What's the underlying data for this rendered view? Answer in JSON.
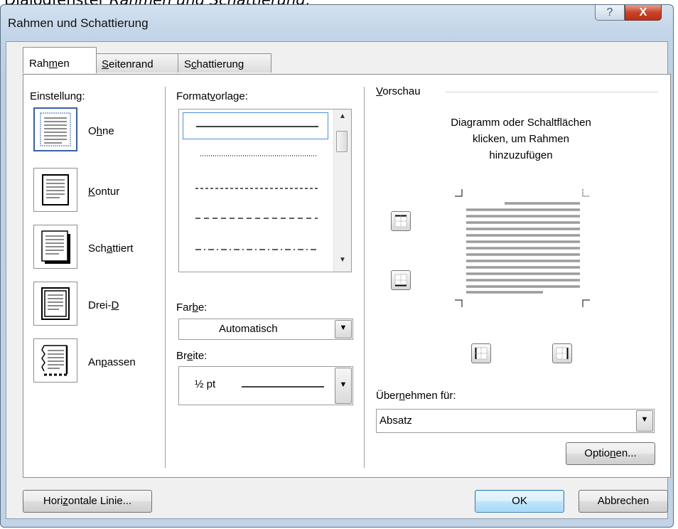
{
  "caption": {
    "prefix": "Dialogfenster ",
    "title": "Rahmen und Schattierung",
    "suffix": "."
  },
  "window": {
    "title": "Rahmen und Schattierung",
    "help_glyph": "?",
    "close_glyph": "X"
  },
  "tabs": [
    {
      "pre": "Rah",
      "key": "m",
      "post": "en",
      "active": true
    },
    {
      "pre": "",
      "key": "S",
      "post": "eitenrand",
      "active": false
    },
    {
      "pre": "S",
      "key": "c",
      "post": "hattierung",
      "active": false
    }
  ],
  "settings": {
    "heading": "Einstellung:",
    "items": [
      {
        "pre": "O",
        "key": "h",
        "post": "ne",
        "icon": "setting-none-icon"
      },
      {
        "pre": "",
        "key": "K",
        "post": "ontur",
        "icon": "setting-box-icon"
      },
      {
        "pre": "Sch",
        "key": "a",
        "post": "ttiert",
        "icon": "setting-shadow-icon"
      },
      {
        "pre": "Drei-",
        "key": "D",
        "post": "",
        "icon": "setting-3d-icon"
      },
      {
        "pre": "An",
        "key": "p",
        "post": "assen",
        "icon": "setting-custom-icon"
      }
    ]
  },
  "style": {
    "heading_pre": "Format",
    "heading_key": "v",
    "heading_post": "orlage:",
    "line_styles": [
      "solid",
      "dotted",
      "dashed-small",
      "dashed",
      "dash-dot"
    ],
    "color_label_pre": "Far",
    "color_label_key": "b",
    "color_label_post": "e:",
    "color_value": "Automatisch",
    "width_label_pre": "Br",
    "width_label_key": "e",
    "width_label_post": "ite:",
    "width_value": "½ pt"
  },
  "preview": {
    "heading_pre": "",
    "heading_key": "V",
    "heading_post": "orschau",
    "hint_lines": [
      "Diagramm oder Schaltflächen",
      "klicken, um Rahmen",
      "hinzuzufügen"
    ],
    "buttons": [
      "top-border-icon",
      "bottom-border-icon",
      "left-border-icon",
      "right-border-icon"
    ]
  },
  "apply": {
    "label_pre": "Über",
    "label_key": "n",
    "label_post": "ehmen für:",
    "value": "Absatz",
    "options_pre": "Optio",
    "options_key": "n",
    "options_post": "en..."
  },
  "footer": {
    "hline_pre": "Hori",
    "hline_key": "z",
    "hline_post": "ontale Linie...",
    "ok": "OK",
    "cancel": "Abbrechen"
  },
  "colors": {
    "selection": "#3a5fa6",
    "chrome": "#c3d5e8",
    "close": "#c8432a"
  }
}
